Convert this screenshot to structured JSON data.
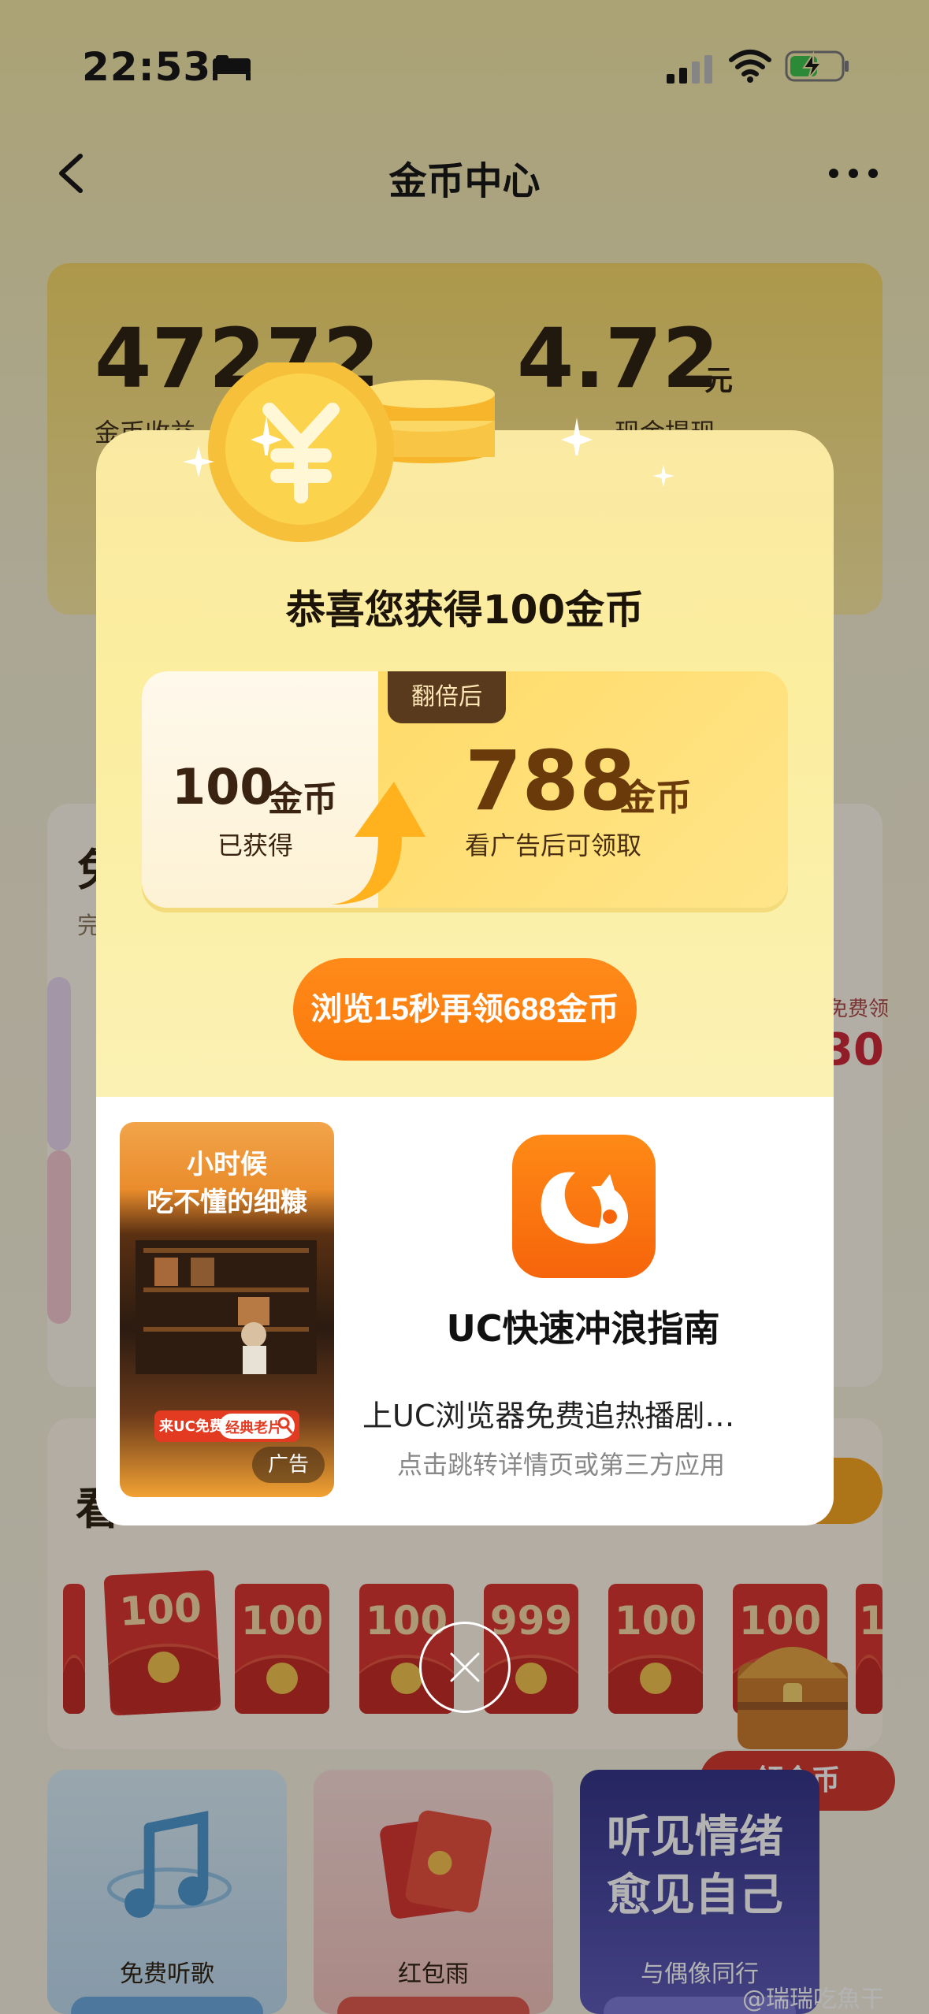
{
  "status_bar": {
    "time": "22:53"
  },
  "nav": {
    "title": "金币中心"
  },
  "balance": {
    "coins": "47272",
    "cash": "4.72",
    "cash_unit": "元",
    "coins_label": "金币收益",
    "cash_label": "现金提现"
  },
  "task": {
    "title": "免",
    "subtitle": "完",
    "side_label": "免费领",
    "side_amount": "30"
  },
  "watch": {
    "title": "看",
    "envelopes": [
      "100",
      "100",
      "100",
      "999",
      "100",
      "100",
      "1"
    ]
  },
  "claim_button": "领金币",
  "features": [
    {
      "label": "免费听歌",
      "color": "#cfe3f2"
    },
    {
      "label": "红包雨",
      "color": "#f6d2cf"
    },
    {
      "label": "与偶像同行",
      "color": "#3f3b8c"
    }
  ],
  "feature_poster_text": [
    "听见情绪",
    "愈见自己"
  ],
  "watermark": "@瑞瑞吃魚干",
  "modal": {
    "heading": "恭喜您获得100金币",
    "got_amount": "100",
    "got_unit": "金币",
    "got_label": "已获得",
    "double_tag": "翻倍后",
    "double_amount": "788",
    "double_unit": "金币",
    "double_label": "看广告后可领取",
    "browse_button": "浏览15秒再领688金币"
  },
  "ad": {
    "thumb_line1": "小时候",
    "thumb_line2": "吃不懂的细糠",
    "thumb_banner_text": "来UC免费看",
    "thumb_banner_btn": "经典老片",
    "tag": "广告",
    "app_name": "UC快速冲浪指南",
    "description": "上UC浏览器免费追热播剧…",
    "hint": "点击跳转详情页或第三方应用"
  },
  "colors": {
    "accent_orange": "#fb7a0b",
    "brand_red": "#d5332a",
    "gold": "#ffd75c"
  }
}
